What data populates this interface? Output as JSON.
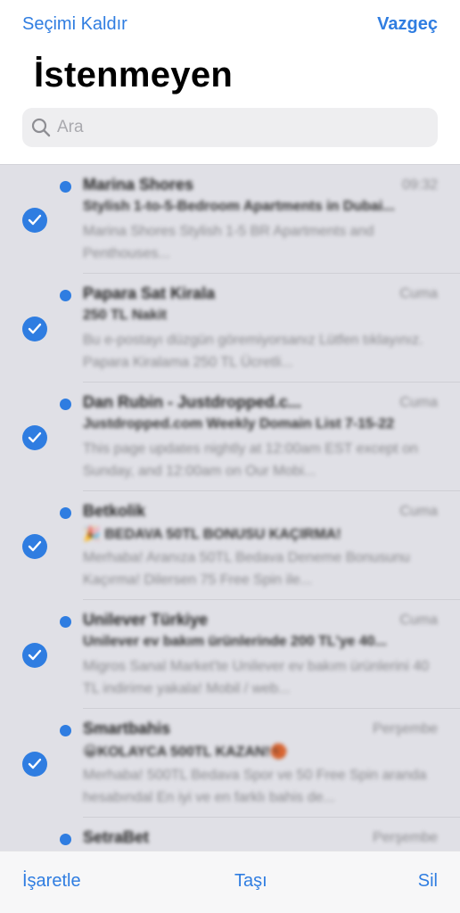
{
  "nav": {
    "deselect_label": "Seçimi Kaldır",
    "cancel_label": "Vazgeç",
    "title": "İstenmeyen"
  },
  "search": {
    "placeholder": "Ara"
  },
  "messages": [
    {
      "sender": "Marina Shores",
      "time": "09:32",
      "subject": "Stylish 1-to-5-Bedroom Apartments in Dubai...",
      "preview": "Marina Shores Stylish 1-5 BR Apartments and Penthouses..."
    },
    {
      "sender": "Papara Sat Kirala",
      "time": "Cuma",
      "subject": "250 TL Nakit",
      "preview": "Bu e-postayı düzgün göremiyorsanız Lütfen tıklayınız. Papara Kiralama 250 TL Ücretli..."
    },
    {
      "sender": "Dan Rubin - Justdropped.c...",
      "time": "Cuma",
      "subject": "Justdropped.com Weekly Domain List 7-15-22",
      "preview": "This page updates nightly at 12:00am EST except on Sunday, and 12:00am on Our Mobi..."
    },
    {
      "sender": "Betkolik",
      "time": "Cuma",
      "subject": "🎉 BEDAVA 50TL BONUSU KAÇIRMA!",
      "preview": "Merhaba! Aranıza 50TL Bedava Deneme Bonusunu Kaçırma! Dilersen 75 Free Spin ile..."
    },
    {
      "sender": "Unilever Türkiye",
      "time": "Cuma",
      "subject": "Unilever ev bakım ürünlerinde 200 TL'ye 40...",
      "preview": "Migros Sanal Market'te Unilever ev bakım ürünlerini 40 TL indirime yakala! Mobil / web..."
    },
    {
      "sender": "Smartbahis",
      "time": "Perşembe",
      "subject": "😀KOLAYCA 500TL KAZAN!🏀",
      "preview": "Merhaba! 500TL Bedava Spor ve 50 Free Spin aranda hesabındal En iyi ve en farklı bahis de..."
    },
    {
      "sender": "SetraBet",
      "time": "Perşembe",
      "subject": "",
      "preview": ""
    }
  ],
  "toolbar": {
    "mark_label": "İşaretle",
    "move_label": "Taşı",
    "delete_label": "Sil"
  },
  "colors": {
    "accent": "#2f7de1",
    "list_background": "#e0e0e6"
  }
}
